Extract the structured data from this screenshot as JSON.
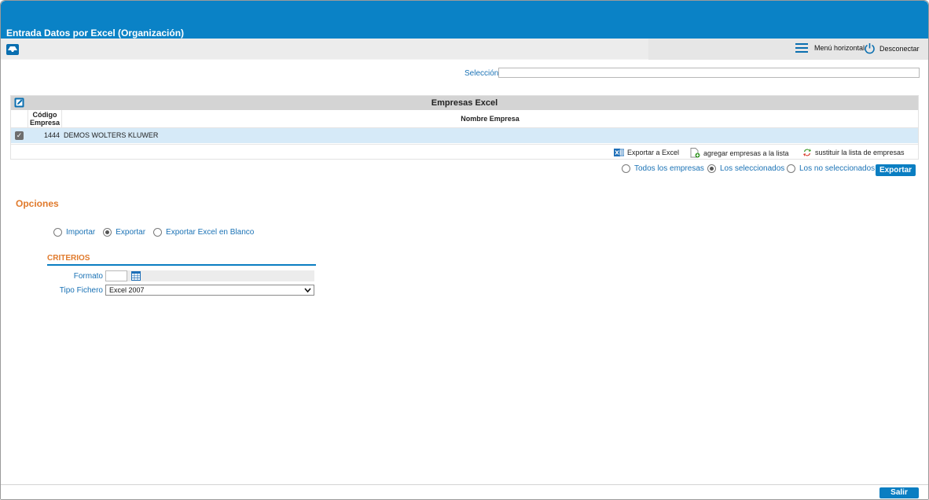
{
  "app": {
    "title": "Entrada Datos por Excel (Organización)"
  },
  "toolbar": {
    "menu_label": "Menú horizontal",
    "disconnect_label": "Desconectar"
  },
  "seleccion": {
    "label": "Selección",
    "value": ""
  },
  "grid": {
    "title": "Empresas Excel",
    "columns": {
      "code": "Código Empresa",
      "name": "Nombre Empresa"
    },
    "rows": [
      {
        "checked": true,
        "code": "1444",
        "name": "DEMOS WOLTERS KLUWER"
      }
    ],
    "actions": {
      "export_excel": "Exportar a Excel",
      "add_companies": "agregar empresas a la lista",
      "replace_companies": "sustituir la lista de empresas"
    }
  },
  "scope": {
    "options": [
      "Todos los empresas",
      "Los seleccionados",
      "Los no seleccionados"
    ],
    "selected": "Los seleccionados",
    "button": "Exportar"
  },
  "opciones": {
    "title": "Opciones",
    "options": [
      "Importar",
      "Exportar",
      "Exportar Excel en Blanco"
    ],
    "selected": "Exportar"
  },
  "criterios": {
    "title": "CRITERIOS",
    "formato_label": "Formato",
    "formato_value": "",
    "tipo_label": "Tipo Fichero",
    "tipo_value": "Excel 2007"
  },
  "footer": {
    "salir": "Salir"
  },
  "colors": {
    "brand": "#0a82c6",
    "accent": "#e07a2c",
    "link": "#1a72b5",
    "selected_row": "#d6eaf8"
  }
}
